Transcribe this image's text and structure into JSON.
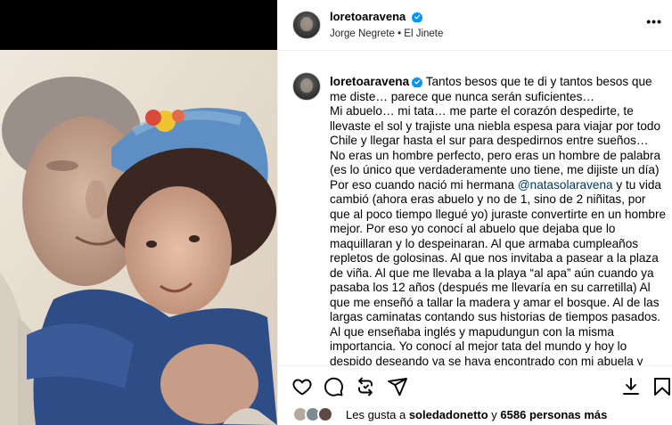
{
  "post": {
    "username": "loretoaravena",
    "audio": "Jorge Negrete • El Jinete",
    "more_label": "•••"
  },
  "caption": {
    "username": "loretoaravena",
    "intro": "Tantos besos que te di y tantos besos que me diste… parece que nunca serán suficientes…",
    "p2": "Mi abuelo… mi tata… me parte el corazón despedirte, te llevaste el sol y trajiste una niebla espesa para viajar por todo Chile y llegar hasta el sur para despedirnos entre sueños…",
    "p3_before": "No eras un hombre perfecto, pero eras un hombre de palabra (es lo único que verdaderamente uno tiene, me dijiste un día) Por eso cuando nació mi hermana ",
    "mention": "@natasolaravena",
    "p3_after": " y tu vida cambió (ahora eras abuelo y no de 1, sino de 2 niñitas, por que al poco tiempo llegué yo) juraste convertirte en un hombre mejor. Por eso yo conocí al abuelo que dejaba que lo maquillaran y lo despeinaran. Al que armaba cumpleaños repletos de golosinas. Al que nos invitaba a pasear a la plaza de viña. Al que me llevaba a la playa “al apa” aún cuando ya pasaba los 12 años (después me llevaría en su carretilla) Al que me enseñó a tallar la madera y amar el bosque. Al de las largas caminatas contando sus historias de tiempos pasados. Al que enseñaba inglés y mapudungun con la misma importancia. Yo conocí al mejor tata del mundo y hoy lo despido deseando ya se haya encontrado con mi abuela y estén otra vez de la mano danzando en algún lugar paradisíaco cerquita"
  },
  "likes": {
    "prefix": "Les gusta a ",
    "user": "soledadonetto",
    "middle": " y ",
    "count": "6586 personas más"
  },
  "colors": {
    "link": "#00376b",
    "verified": "#0095f6",
    "divider": "#efefef"
  },
  "icons": [
    "heart-icon",
    "comment-icon",
    "repost-icon",
    "share-icon",
    "download-icon",
    "bookmark-icon"
  ]
}
